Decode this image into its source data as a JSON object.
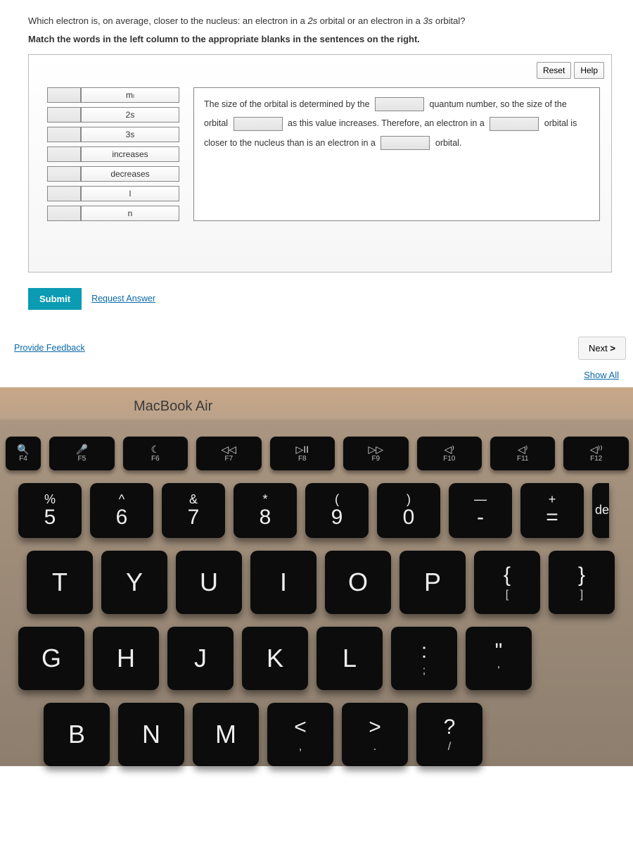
{
  "question": {
    "line1_a": "Which electron is, on average, closer to the nucleus: an electron in a ",
    "orb1": "2s",
    "line1_b": " orbital or an electron in a ",
    "orb2": "3s",
    "line1_c": " orbital?",
    "bold": "Match the words in the left column to the appropriate blanks in the sentences on the right."
  },
  "buttons": {
    "reset": "Reset",
    "help": "Help",
    "submit": "Submit",
    "request": "Request Answer",
    "next": "Next",
    "showall": "Show All"
  },
  "words": [
    "mₗ",
    "2s",
    "3s",
    "increases",
    "decreases",
    "l",
    "n"
  ],
  "sentence": {
    "p1": "The size of the orbital is determined by the",
    "p2": "quantum number, so the size of the orbital",
    "p3": "as this value increases. Therefore, an electron in a",
    "p4": "orbital is closer to",
    "p5": "the nucleus than is an electron in a",
    "p6": "orbital."
  },
  "links": {
    "feedback": "Provide Feedback"
  },
  "mac": "MacBook Air",
  "frow": [
    {
      "icon": "🔍",
      "lbl": "F4",
      "small": true
    },
    {
      "icon": "🎤",
      "lbl": "F5"
    },
    {
      "icon": "☾",
      "lbl": "F6"
    },
    {
      "icon": "◁◁",
      "lbl": "F7"
    },
    {
      "icon": "▷II",
      "lbl": "F8"
    },
    {
      "icon": "▷▷",
      "lbl": "F9"
    },
    {
      "icon": "◁⁾",
      "lbl": "F10"
    },
    {
      "icon": "◁⁾",
      "lbl": "F11"
    },
    {
      "icon": "◁⁾⁾",
      "lbl": "F12"
    }
  ],
  "numrow": [
    {
      "top": "%",
      "bot": "5"
    },
    {
      "top": "^",
      "bot": "6"
    },
    {
      "top": "&",
      "bot": "7"
    },
    {
      "top": "*",
      "bot": "8"
    },
    {
      "top": "(",
      "bot": "9"
    },
    {
      "top": ")",
      "bot": "0"
    },
    {
      "top": "—",
      "bot": "-"
    },
    {
      "top": "+",
      "bot": "="
    }
  ],
  "row3": [
    {
      "c": "T"
    },
    {
      "c": "Y"
    },
    {
      "c": "U"
    },
    {
      "c": "I"
    },
    {
      "c": "O"
    },
    {
      "c": "P"
    },
    {
      "c": "{",
      "sub": "["
    },
    {
      "c": "}",
      "sub": "]"
    }
  ],
  "row4": [
    {
      "c": "G"
    },
    {
      "c": "H"
    },
    {
      "c": "J"
    },
    {
      "c": "K"
    },
    {
      "c": "L"
    },
    {
      "c": ":",
      "sub": ";"
    },
    {
      "c": "\"",
      "sub": "'"
    }
  ],
  "row5": [
    {
      "c": "B"
    },
    {
      "c": "N"
    },
    {
      "c": "M"
    },
    {
      "c": "<",
      "sub": ","
    },
    {
      "c": ">",
      "sub": "."
    },
    {
      "c": "?",
      "sub": "/"
    }
  ],
  "clip": "de"
}
